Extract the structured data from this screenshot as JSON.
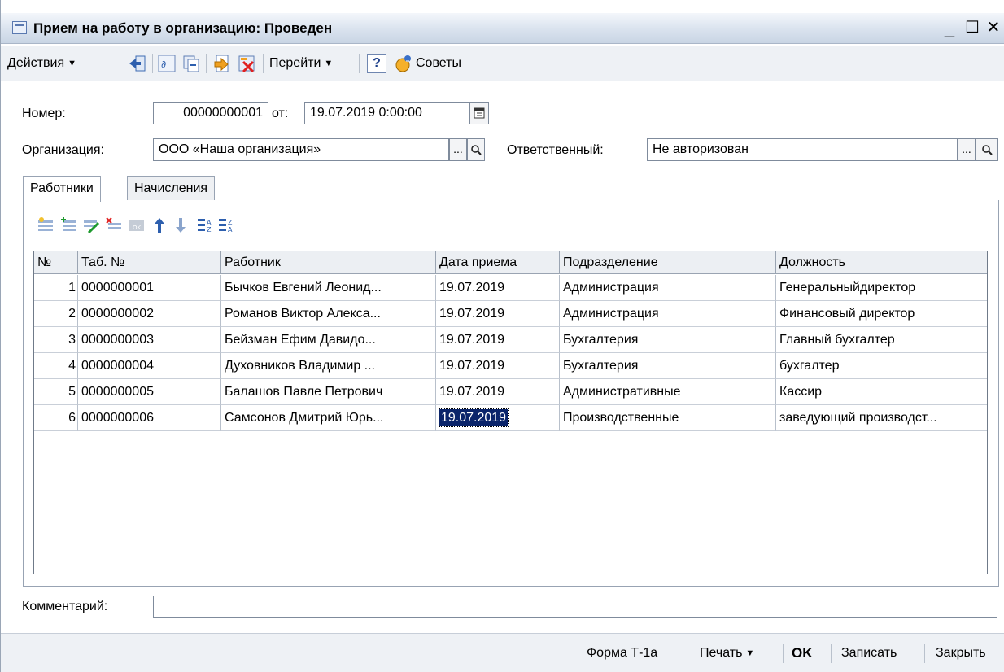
{
  "window": {
    "title": "Прием на работу в организацию: Проведен",
    "minimize": "_",
    "maximize": "☐",
    "close": "✕"
  },
  "toolbar": {
    "actions_label": "Действия",
    "goto_label": "Перейти",
    "help_label": "?",
    "tips_label": "Советы"
  },
  "form": {
    "number_label": "Номер:",
    "number_value": "00000000001",
    "date_label": "от:",
    "date_value": "19.07.2019  0:00:00",
    "organization_label": "Организация:",
    "organization_value": "ООО «Наша организация»",
    "responsible_label": "Ответственный:",
    "responsible_value": "Не авторизован",
    "ellipsis": "...",
    "search": "🔍"
  },
  "tabs": [
    {
      "label": "Работники",
      "active": true
    },
    {
      "label": "Начисления",
      "active": false
    }
  ],
  "table": {
    "columns": [
      "№",
      "Таб. №",
      "Работник",
      "Дата приема",
      "Подразделение",
      "Должность"
    ],
    "rows": [
      [
        "1",
        "0000000001",
        "Бычков Евгений Леонид...",
        "19.07.2019",
        "Администрация",
        "Генеральныйдиректор"
      ],
      [
        "2",
        "0000000002",
        "Романов Виктор Алекса...",
        "19.07.2019",
        "Администрация",
        "Финансовый директор"
      ],
      [
        "3",
        "0000000003",
        "Бейзман  Ефим Давидо...",
        "19.07.2019",
        "Бухгалтерия",
        "Главный бухгалтер"
      ],
      [
        "4",
        "0000000004",
        "Духовников Владимир ...",
        "19.07.2019",
        "Бухгалтерия",
        "бухгалтер"
      ],
      [
        "5",
        "0000000005",
        "Балашов Павле Петрович",
        "19.07.2019",
        "Административные",
        "Кассир"
      ],
      [
        "6",
        "0000000006",
        "Самсонов Дмитрий Юрь...",
        "19.07.2019",
        "Производственные",
        "заведующий производст..."
      ]
    ],
    "selected_row": 5,
    "selected_column": 3
  },
  "comment": {
    "label": "Комментарий:",
    "value": ""
  },
  "bottom": {
    "form_t1a": "Форма Т-1а",
    "print": "Печать",
    "ok": "OK",
    "save": "Записать",
    "close": "Закрыть"
  },
  "colors": {
    "selection": "#0a246a",
    "toolbar_bg": "#eef1f5",
    "title_gradient_top": "#f4f7fb"
  }
}
